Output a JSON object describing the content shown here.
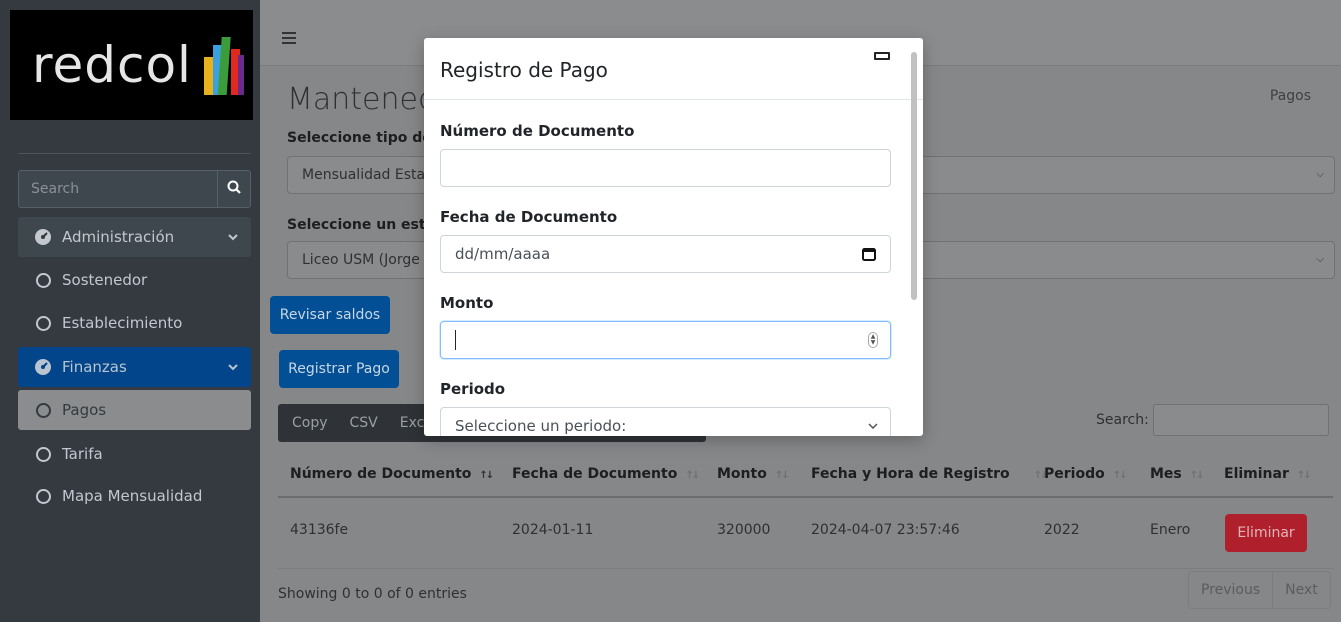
{
  "sidebar": {
    "brand": "redcol",
    "search_placeholder": "Search",
    "items": [
      {
        "label": "Administración",
        "icon": "dashboard-icon"
      },
      {
        "label": "Sostenedor",
        "icon": "circle-icon"
      },
      {
        "label": "Establecimiento",
        "icon": "circle-icon"
      },
      {
        "label": "Finanzas",
        "icon": "dashboard-icon"
      },
      {
        "label": "Pagos",
        "icon": "circle-icon"
      },
      {
        "label": "Tarifa",
        "icon": "circle-icon"
      },
      {
        "label": "Mapa Mensualidad",
        "icon": "circle-icon"
      }
    ]
  },
  "main": {
    "title": "Mantenedo",
    "breadcrumb": "Pagos",
    "type_label": "Seleccione tipo de p",
    "type_value": "Mensualidad Estab",
    "estab_label": "Seleccione un estab",
    "estab_value": "Liceo USM (Jorge F",
    "btn_saldos": "Revisar saldos",
    "btn_registrar": "Registrar Pago",
    "dt_buttons": [
      "Copy",
      "CSV",
      "Exc"
    ],
    "search_label": "Search:",
    "columns": [
      "Número de Documento",
      "Fecha de Documento",
      "Monto",
      "Fecha y Hora de Registro",
      "Periodo",
      "Mes",
      "Eliminar"
    ],
    "row": {
      "numero": "43136fe",
      "fecha": "2024-01-11",
      "monto": "320000",
      "registro": "2024-04-07 23:57:46",
      "periodo": "2022",
      "mes": "Enero",
      "eliminar": "Eliminar"
    },
    "info": "Showing 0 to 0 of 0 entries",
    "pager": {
      "prev": "Previous",
      "next": "Next"
    }
  },
  "modal": {
    "title": "Registro de Pago",
    "numero_label": "Número de Documento",
    "numero_value": "",
    "fecha_label": "Fecha de Documento",
    "fecha_value": "dd/mm/aaaa",
    "monto_label": "Monto",
    "monto_value": "",
    "periodo_label": "Periodo",
    "periodo_value": "Seleccione un periodo:"
  },
  "colors": {
    "sidebar_bg": "#343a40",
    "primary": "#007bff",
    "danger": "#dc3545"
  }
}
